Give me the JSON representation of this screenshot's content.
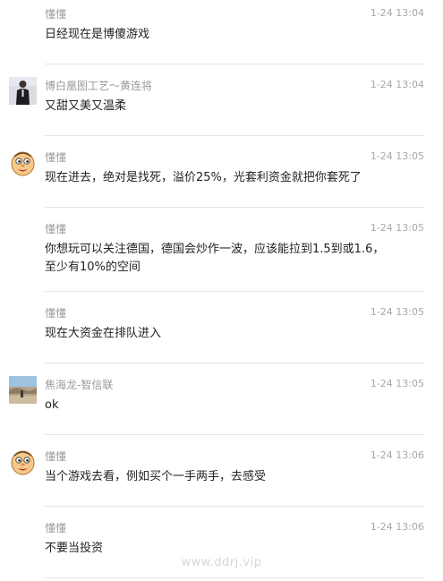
{
  "messages": [
    {
      "sender": "懂懂",
      "time": "1-24 13:04",
      "text": "日经现在是博傻游戏",
      "avatar": "none"
    },
    {
      "sender": "博白凰图工艺～黄连将",
      "time": "1-24 13:04",
      "text": "又甜又美又温柔",
      "avatar": "person-photo-icon"
    },
    {
      "sender": "懂懂",
      "time": "1-24 13:05",
      "text": "现在进去，绝对是找死，溢价25%，光套利资金就把你套死了",
      "avatar": "cartoon-face-icon"
    },
    {
      "sender": "懂懂",
      "time": "1-24 13:05",
      "text": "你想玩可以关注德国，德国会炒作一波，应该能拉到1.5到或1.6，至少有10%的空间",
      "avatar": "none"
    },
    {
      "sender": "懂懂",
      "time": "1-24 13:05",
      "text": "现在大资金在排队进入",
      "avatar": "none"
    },
    {
      "sender": "焦海龙-智信联",
      "time": "1-24 13:05",
      "text": "ok",
      "avatar": "landscape-photo-icon"
    },
    {
      "sender": "懂懂",
      "time": "1-24 13:06",
      "text": "当个游戏去看，例如买个一手两手，去感受",
      "avatar": "cartoon-face-icon"
    },
    {
      "sender": "懂懂",
      "time": "1-24 13:06",
      "text": "不要当投资",
      "avatar": "none"
    }
  ],
  "watermark": "www.ddrj.vip"
}
